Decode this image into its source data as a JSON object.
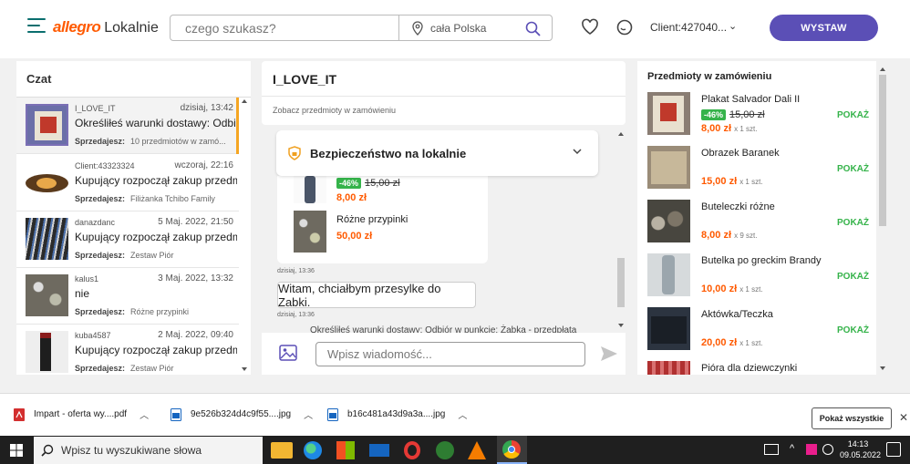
{
  "header": {
    "logo_brand": "allegro",
    "logo_sub": "Lokalnie",
    "search_placeholder": "czego szukasz?",
    "location": "cała Polska",
    "client": "Client:427040...",
    "wystaw_label": "WYSTAW"
  },
  "chat_list": {
    "title": "Czat",
    "items": [
      {
        "user": "I_LOVE_IT",
        "date": "dzisiaj, 13:42",
        "message": "Określiłeś warunki dostawy: Odbi...",
        "seller_label": "Sprzedajesz:",
        "seller_item": "10 przedmiotów w zamó..."
      },
      {
        "user": "Client:43323324",
        "date": "wczoraj, 22:16",
        "message": "Kupujący rozpoczął zakup przedm...",
        "seller_label": "Sprzedajesz:",
        "seller_item": "Filiżanka Tchibo Family"
      },
      {
        "user": "danazdanc",
        "date": "5 Maj. 2022, 21:50",
        "message": "Kupujący rozpoczął zakup przedm...",
        "seller_label": "Sprzedajesz:",
        "seller_item": "Zestaw Piór"
      },
      {
        "user": "kalus1",
        "date": "3 Maj. 2022, 13:32",
        "message": "nie",
        "seller_label": "Sprzedajesz:",
        "seller_item": "Różne przypinki"
      },
      {
        "user": "kuba4587",
        "date": "2 Maj. 2022, 09:40",
        "message": "Kupujący rozpoczął zakup przedm...",
        "seller_label": "Sprzedajesz:",
        "seller_item": "Zestaw Piór"
      }
    ]
  },
  "conversation": {
    "title": "I_LOVE_IT",
    "items_link": "Zobacz przedmioty w zamówieniu",
    "security_title": "Bezpieczeństwo na lokalnie",
    "card_items": [
      {
        "badge": "-46%",
        "old_price": "15,00 zł",
        "price": "8,00 zł"
      },
      {
        "name": "Różne przypinki",
        "price": "50,00 zł"
      }
    ],
    "ts1": "dzisiaj, 13:36",
    "bubble": "Witam, chciałbym przesylke do Zabki.",
    "ts2": "dzisiaj, 13:36",
    "system_msg": "Określiłeś warunki dostawy: Odbiór w punkcie: Żabka - przedpłata",
    "input_placeholder": "Wpisz wiadomość..."
  },
  "orders": {
    "title": "Przedmioty w zamówieniu",
    "show_label": "POKAŻ",
    "items": [
      {
        "name": "Plakat Salvador Dali II",
        "badge": "-46%",
        "old_price": "15,00 zł",
        "price": "8,00 zł",
        "qty": "x 1 szt."
      },
      {
        "name": "Obrazek Baranek",
        "price": "15,00 zł",
        "qty": "x 1 szt."
      },
      {
        "name": "Buteleczki różne",
        "price": "8,00 zł",
        "qty": "x 9 szt."
      },
      {
        "name": "Butelka po greckim Brandy",
        "price": "10,00 zł",
        "qty": "x 1 szt."
      },
      {
        "name": "Aktówka/Teczka",
        "price": "20,00 zł",
        "qty": "x 1 szt."
      },
      {
        "name": "Pióra dla dziewczynki",
        "price": "",
        "qty": ""
      }
    ]
  },
  "downloads": {
    "items": [
      "Impart - oferta wy....pdf",
      "9e526b324d4c9f55....jpg",
      "b16c481a43d9a3a....jpg"
    ],
    "show_all": "Pokaż wszystkie"
  },
  "taskbar": {
    "search": "Wpisz tu wyszukiwane słowa",
    "time": "14:13",
    "date": "09.05.2022"
  },
  "colors": {
    "accent": "#5b4fb6",
    "brand": "#ff5a00",
    "price": "#ff5a00",
    "show": "#35b34a",
    "selected_bar": "#f5a623"
  }
}
